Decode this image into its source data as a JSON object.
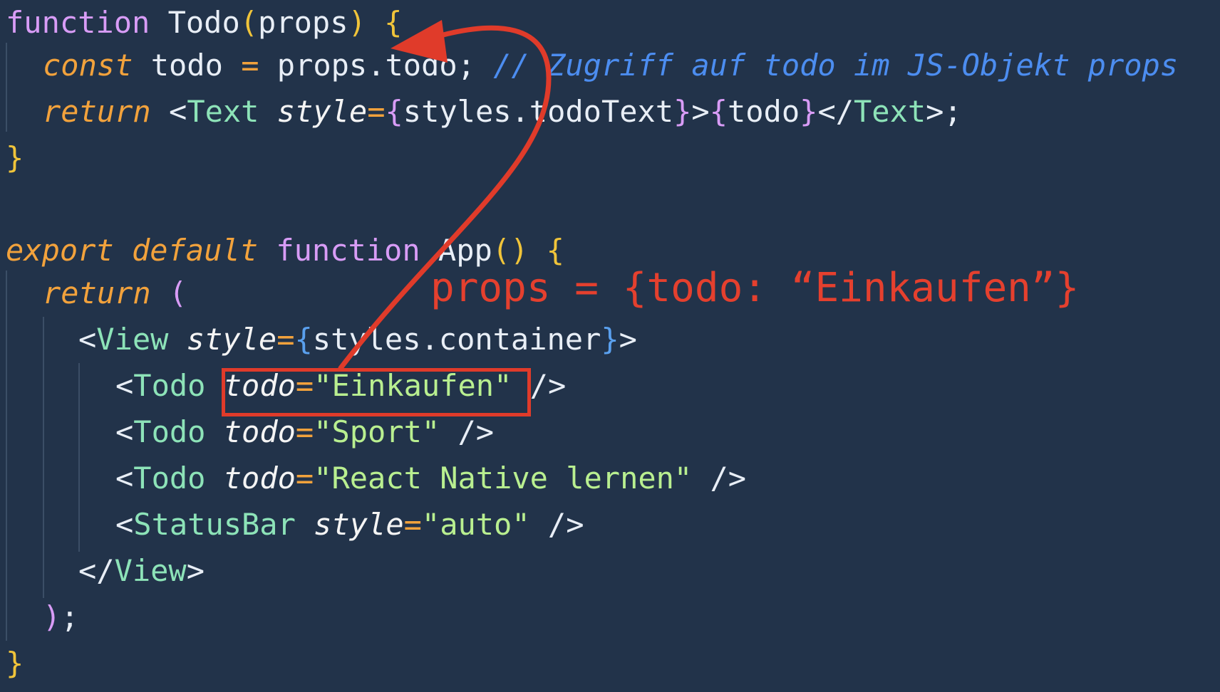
{
  "code": {
    "l1": {
      "kw": "function",
      "name": "Todo",
      "p1": "(",
      "param": "props",
      "p2": ")",
      "brace": "{"
    },
    "l2": {
      "kw": "const",
      "a": "todo",
      "eq": "=",
      "b": "props.todo;",
      "comment": "// Zugriff auf todo im JS-Objekt props"
    },
    "l3": {
      "kw": "return",
      "lt": "<",
      "tag": "Text",
      "attr": "style",
      "eq": "=",
      "b1": "{",
      "expr": "styles.todoText",
      "b2": "}",
      "gt": ">",
      "b3": "{",
      "val": "todo",
      "b4": "}",
      "close": "</",
      "ctag": "Text",
      "end": ">;"
    },
    "l4": {
      "brace": "}"
    },
    "l6": {
      "kw1": "export",
      "kw2": "default",
      "kw3": "function",
      "name": "App",
      "p": "()",
      "brace": "{"
    },
    "l7": {
      "kw": "return",
      "p": "("
    },
    "l8": {
      "lt": "<",
      "tag": "View",
      "attr": "style",
      "eq": "=",
      "b1": "{",
      "expr": "styles.container",
      "b2": "}",
      "gt": ">"
    },
    "l9": {
      "lt": "<",
      "tag": "Todo",
      "attr": "todo",
      "eq": "=",
      "val": "\"Einkaufen\"",
      "end": "/>"
    },
    "l10": {
      "lt": "<",
      "tag": "Todo",
      "attr": "todo",
      "eq": "=",
      "val": "\"Sport\"",
      "end": "/>"
    },
    "l11": {
      "lt": "<",
      "tag": "Todo",
      "attr": "todo",
      "eq": "=",
      "val": "\"React Native lernen\"",
      "end": "/>"
    },
    "l12": {
      "lt": "<",
      "tag": "StatusBar",
      "attr": "style",
      "eq": "=",
      "val": "\"auto\"",
      "end": "/>"
    },
    "l13": {
      "lt": "</",
      "tag": "View",
      "gt": ">"
    },
    "l14": {
      "p": ")",
      "semi": ";"
    },
    "l15": {
      "brace": "}"
    }
  },
  "annotation": {
    "text": "props = {todo: “Einkaufen”}"
  },
  "colors": {
    "background": "#22334a",
    "annotation": "#e5402e"
  }
}
